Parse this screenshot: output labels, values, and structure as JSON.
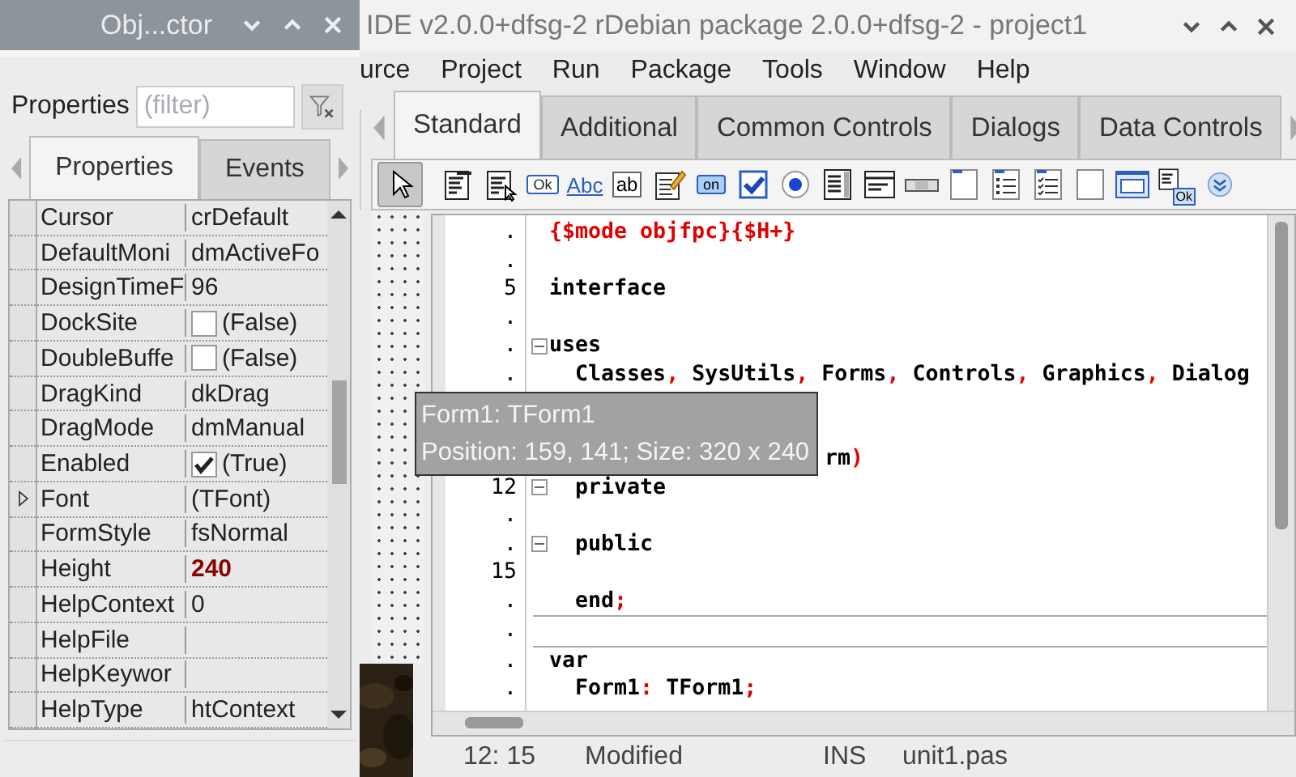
{
  "inspector": {
    "title": "Obj...ctor",
    "filter_label": "Properties",
    "filter": {
      "placeholder": "(filter)"
    },
    "tabs": [
      {
        "label": "Properties",
        "selected": true
      },
      {
        "label": "Events",
        "selected": false
      }
    ],
    "rows": [
      {
        "name": "Cursor",
        "kind": "text",
        "value": "crDefault",
        "modified": false
      },
      {
        "name": "DefaultMoni",
        "kind": "text",
        "value": "dmActiveFo",
        "modified": false
      },
      {
        "name": "DesignTimeF",
        "kind": "text",
        "value": "96",
        "modified": false
      },
      {
        "name": "DockSite",
        "kind": "checkbox",
        "checked": false,
        "value": "(False)",
        "modified": false
      },
      {
        "name": "DoubleBuffe",
        "kind": "checkbox",
        "checked": false,
        "value": "(False)",
        "modified": false
      },
      {
        "name": "DragKind",
        "kind": "text",
        "value": "dkDrag",
        "modified": false
      },
      {
        "name": "DragMode",
        "kind": "text",
        "value": "dmManual",
        "modified": false
      },
      {
        "name": "Enabled",
        "kind": "checkbox",
        "checked": true,
        "value": "(True)",
        "modified": false
      },
      {
        "name": "Font",
        "kind": "object",
        "value": "(TFont)",
        "modified": false
      },
      {
        "name": "FormStyle",
        "kind": "text",
        "value": "fsNormal",
        "modified": false
      },
      {
        "name": "Height",
        "kind": "text",
        "value": "240",
        "modified": true
      },
      {
        "name": "HelpContext",
        "kind": "text",
        "value": "0",
        "modified": false
      },
      {
        "name": "HelpFile",
        "kind": "text",
        "modified": false
      },
      {
        "name": "HelpKeywor",
        "kind": "text",
        "modified": false
      },
      {
        "name": "HelpType",
        "kind": "text",
        "value": "htContext",
        "modified": false
      }
    ]
  },
  "window": {
    "title": "IDE v2.0.0+dfsg-2 rDebian package 2.0.0+dfsg-2 - project1"
  },
  "menu": [
    "urce",
    "Project",
    "Run",
    "Package",
    "Tools",
    "Window",
    "Help"
  ],
  "palette_tabs": [
    {
      "label": "Standard",
      "selected": true
    },
    {
      "label": "Additional",
      "selected": false
    },
    {
      "label": "Common Controls",
      "selected": false
    },
    {
      "label": "Dialogs",
      "selected": false
    },
    {
      "label": "Data Controls",
      "selected": false
    }
  ],
  "components": [
    {
      "kind": "pointer",
      "selected": true
    },
    {
      "kind": "menu",
      "selected": false
    },
    {
      "kind": "popup",
      "selected": false
    },
    {
      "kind": "button",
      "label": "Ok",
      "selected": false
    },
    {
      "kind": "label",
      "label": "Abc",
      "selected": false
    },
    {
      "kind": "edit",
      "label": "ab",
      "selected": false
    },
    {
      "kind": "memo",
      "selected": false
    },
    {
      "kind": "toggle",
      "label": "on",
      "selected": false
    },
    {
      "kind": "checkbox",
      "selected": false
    },
    {
      "kind": "radio",
      "selected": false
    },
    {
      "kind": "listbox",
      "selected": false
    },
    {
      "kind": "combo",
      "selected": false
    },
    {
      "kind": "scrollbar",
      "selected": false
    },
    {
      "kind": "groupbox",
      "selected": false
    },
    {
      "kind": "radiogroup",
      "selected": false
    },
    {
      "kind": "checkgroup",
      "selected": false
    },
    {
      "kind": "panel",
      "selected": false
    },
    {
      "kind": "frame",
      "selected": false
    },
    {
      "kind": "actionlist",
      "label": "Ok",
      "selected": false
    }
  ],
  "editor": {
    "lines": [
      {
        "number": ".",
        "code": [
          {
            "text": "{$mode objfpc}{$H+}",
            "kind": "directive"
          }
        ]
      },
      {
        "number": "."
      },
      {
        "number": "5",
        "code": [
          {
            "text": "interface",
            "kind": "plain"
          }
        ]
      },
      {
        "number": "."
      },
      {
        "number": ".",
        "fold": true,
        "code": [
          {
            "text": "uses",
            "kind": "plain"
          }
        ]
      },
      {
        "number": ".",
        "code": [
          {
            "text": "  Classes",
            "kind": "plain"
          },
          {
            "text": ",",
            "kind": "symbol"
          },
          {
            "text": " SysUtils",
            "kind": "plain"
          },
          {
            "text": ",",
            "kind": "symbol"
          },
          {
            "text": " Forms",
            "kind": "plain"
          },
          {
            "text": ",",
            "kind": "symbol"
          },
          {
            "text": " Controls",
            "kind": "plain"
          },
          {
            "text": ",",
            "kind": "symbol"
          },
          {
            "text": " Graphics",
            "kind": "plain"
          },
          {
            "text": ",",
            "kind": "symbol"
          },
          {
            "text": " Dialog",
            "kind": "plain"
          }
        ]
      },
      {
        "kind": "below_tooltip",
        "code": [
          {
            "text": "rm",
            "kind": "plain"
          },
          {
            "text": ")",
            "kind": "symbol"
          }
        ]
      },
      {
        "number": "12",
        "fold": true,
        "code": [
          {
            "text": "  private",
            "kind": "plain"
          }
        ]
      },
      {
        "number": "."
      },
      {
        "number": ".",
        "fold": true,
        "code": [
          {
            "text": "  public",
            "kind": "plain"
          }
        ]
      },
      {
        "number": "15"
      },
      {
        "number": ".",
        "code": [
          {
            "text": "  end",
            "kind": "plain"
          },
          {
            "text": ";",
            "kind": "symbol"
          }
        ],
        "rule_below": true
      },
      {
        "number": ".",
        "rule_below": true
      },
      {
        "number": ".",
        "code": [
          {
            "text": "var",
            "kind": "plain"
          }
        ]
      },
      {
        "number": ".",
        "code": [
          {
            "text": "  Form1",
            "kind": "plain"
          },
          {
            "text": ":",
            "kind": "symbol"
          },
          {
            "text": " TForm1",
            "kind": "plain"
          },
          {
            "text": ";",
            "kind": "symbol"
          }
        ]
      }
    ]
  },
  "status_bar": {
    "position": "12: 15",
    "state": "Modified",
    "mode": "INS",
    "file": "unit1.pas"
  },
  "tooltip": {
    "lines": [
      "Form1: TForm1",
      "Position: 159, 141; Size: 320 x 240"
    ]
  }
}
